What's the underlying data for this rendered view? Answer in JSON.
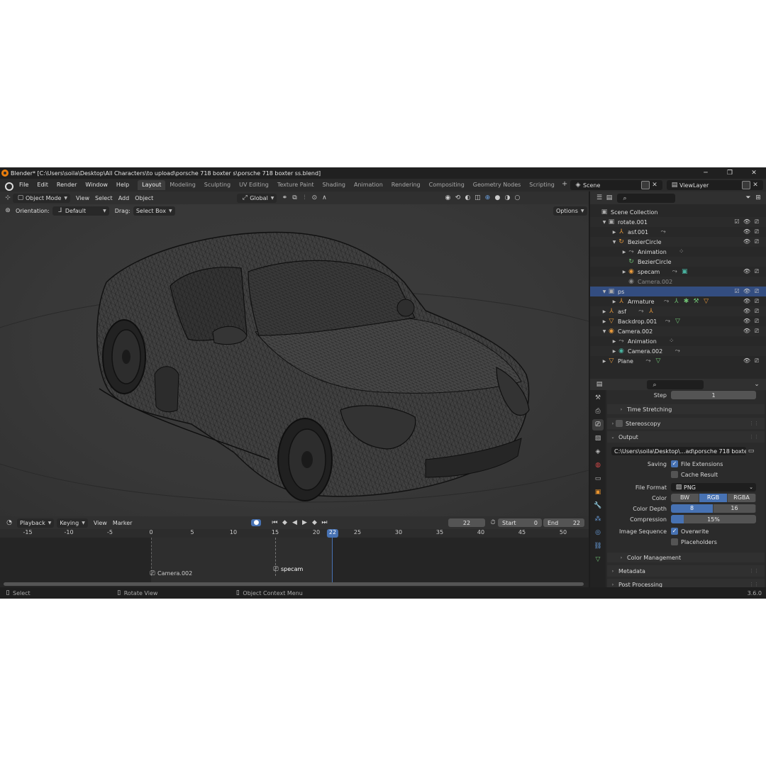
{
  "window": {
    "title": "Blender* [C:\\Users\\soila\\Desktop\\All Characters\\to upload\\porsche 718 boxter s\\porsche 718 boxter ss.blend]",
    "minimize": "─",
    "maximize": "❐",
    "close": "✕"
  },
  "menubar": {
    "items": [
      "File",
      "Edit",
      "Render",
      "Window",
      "Help"
    ],
    "workspaces": [
      "Layout",
      "Modeling",
      "Sculpting",
      "UV Editing",
      "Texture Paint",
      "Shading",
      "Animation",
      "Rendering",
      "Compositing",
      "Geometry Nodes",
      "Scripting"
    ],
    "add_tab": "+",
    "scene": "Scene",
    "view_layer": "ViewLayer"
  },
  "viewport_header": {
    "mode": "Object Mode",
    "menus": [
      "View",
      "Select",
      "Add",
      "Object"
    ],
    "transform": "Global",
    "orientation_label": "Orientation:",
    "orientation_value": "Default",
    "drag_label": "Drag:",
    "drag_value": "Select Box",
    "options": "Options"
  },
  "timeline": {
    "menus": [
      "Playback",
      "Keying",
      "View",
      "Marker"
    ],
    "current_frame": "22",
    "start_label": "Start",
    "start_value": "0",
    "end_label": "End",
    "end_value": "22",
    "ticks": [
      "-15",
      "-10",
      "-5",
      "0",
      "5",
      "10",
      "15",
      "20",
      "25",
      "30",
      "35",
      "40",
      "45",
      "50"
    ],
    "markers": [
      "Camera.002",
      "specam"
    ]
  },
  "statusbar": {
    "select": "Select",
    "rotate": "Rotate View",
    "context": "Object Context Menu",
    "version": "3.6.0"
  },
  "outliner": {
    "search_placeholder": "",
    "rows": [
      {
        "label": "Scene Collection",
        "indent": 0,
        "icon": "▣"
      },
      {
        "label": "rotate.001",
        "indent": 1,
        "icon": "▣"
      },
      {
        "label": "asf.001",
        "indent": 2,
        "icon": "⅄"
      },
      {
        "label": "BezierCircle",
        "indent": 2,
        "icon": "↻"
      },
      {
        "label": "Animation",
        "indent": 3,
        "icon": "⤳"
      },
      {
        "label": "BezierCircle",
        "indent": 3,
        "icon": "↻"
      },
      {
        "label": "specam",
        "indent": 3,
        "icon": "◉"
      },
      {
        "label": "Camera.002",
        "indent": 3,
        "icon": "◉"
      },
      {
        "label": "ps",
        "indent": 1,
        "icon": "▣"
      },
      {
        "label": "Armature",
        "indent": 2,
        "icon": "⅄"
      },
      {
        "label": "asf",
        "indent": 1,
        "icon": "⅄"
      },
      {
        "label": "Backdrop.001",
        "indent": 1,
        "icon": "▽"
      },
      {
        "label": "Camera.002",
        "indent": 1,
        "icon": "◉"
      },
      {
        "label": "Animation",
        "indent": 2,
        "icon": "⤳"
      },
      {
        "label": "Camera.002",
        "indent": 2,
        "icon": "◉"
      },
      {
        "label": "Plane",
        "indent": 1,
        "icon": "▽"
      }
    ]
  },
  "properties": {
    "step_label": "Step",
    "step_value": "1",
    "time_stretching": "Time Stretching",
    "stereoscopy": "Stereoscopy",
    "output": "Output",
    "output_path": "C:\\Users\\soila\\Desktop\\...ad\\porsche 718 boxter s\\",
    "saving_label": "Saving",
    "file_extensions": "File Extensions",
    "cache_result": "Cache Result",
    "file_format_label": "File Format",
    "file_format_value": "PNG",
    "color_label": "Color",
    "color_options": [
      "BW",
      "RGB",
      "RGBA"
    ],
    "color_depth_label": "Color Depth",
    "color_depth_options": [
      "8",
      "16"
    ],
    "compression_label": "Compression",
    "compression_value": "15%",
    "compression_level": 0.15,
    "image_sequence_label": "Image Sequence",
    "overwrite": "Overwrite",
    "placeholders": "Placeholders",
    "color_management": "Color Management",
    "metadata": "Metadata",
    "post_processing": "Post Processing"
  }
}
